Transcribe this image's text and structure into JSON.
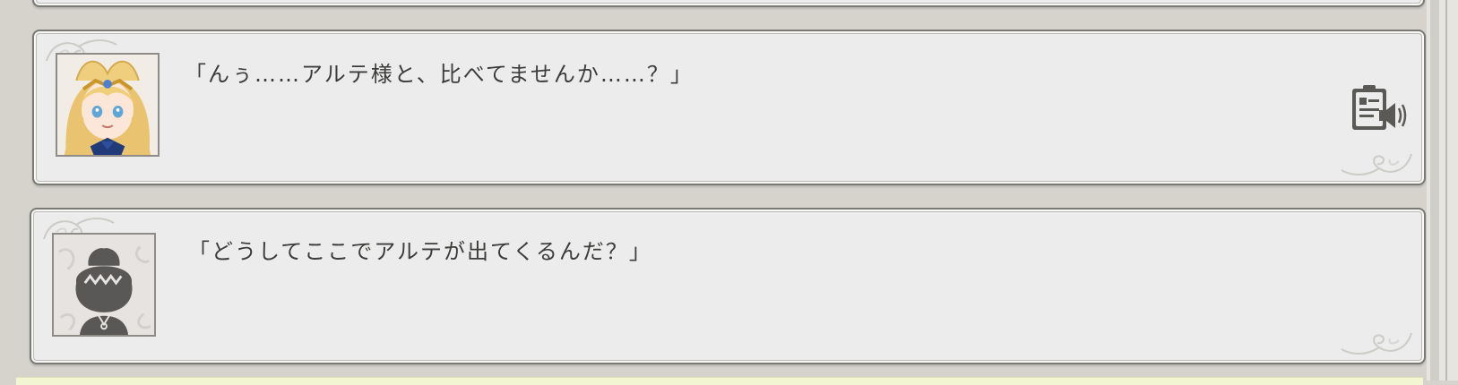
{
  "log": {
    "entries": [
      {
        "speaker_icon": "blonde-girl-portrait",
        "text": "「んぅ……アルテ様と、比べてませんか……？」",
        "has_voice": true,
        "voice_icon": "voice-replay-icon"
      },
      {
        "speaker_icon": "silhouette-portrait",
        "text": "「どうしてここでアルテが出てくるんだ？」",
        "has_voice": false
      }
    ]
  },
  "colors": {
    "background": "#d5d3cc",
    "card": "#ececec",
    "card_border": "#7b7975",
    "text": "#3d3c3a",
    "bottom_strip": "#f3f6d2"
  }
}
